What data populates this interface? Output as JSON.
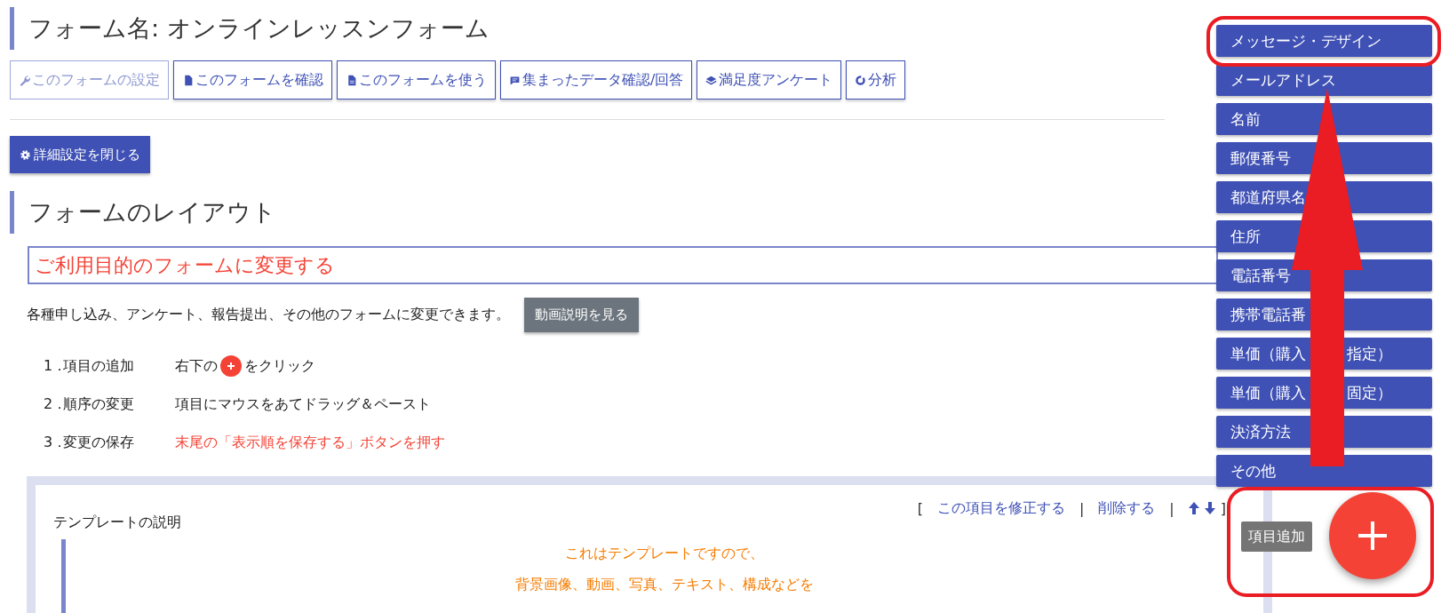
{
  "title": "フォーム名: オンラインレッスンフォーム",
  "toolbar": [
    {
      "label": "このフォームの設定",
      "disabled": true
    },
    {
      "label": "このフォームを確認",
      "disabled": false
    },
    {
      "label": "このフォームを使う",
      "disabled": false
    },
    {
      "label": "集まったデータ確認/回答",
      "disabled": false
    },
    {
      "label": "満足度アンケート",
      "disabled": false
    },
    {
      "label": "分析",
      "disabled": false
    }
  ],
  "detail_button": "詳細設定を閉じる",
  "layout_heading": "フォームのレイアウト",
  "purpose_banner": "ご利用目的のフォームに変更する",
  "description": "各種申し込み、アンケート、報告提出、その他のフォームに変更できます。",
  "video_button": "動画説明を見る",
  "steps": [
    {
      "kind": "plus_hint",
      "number": "1．",
      "title": "項目の追加",
      "text": "右下の",
      "text_after": "をクリック"
    },
    {
      "kind": "plain",
      "number": "2．",
      "title": "順序の変更",
      "text": "項目にマウスをあてドラッグ＆ペースト"
    },
    {
      "kind": "warning",
      "number": "3．",
      "title": "変更の保存",
      "text": "末尾の「表示順を保存する」ボタンを押す"
    }
  ],
  "template": {
    "actions": [
      {
        "kind": "mark",
        "text": "["
      },
      {
        "kind": "link",
        "text": "この項目を修正する"
      },
      {
        "kind": "mark",
        "text": "|"
      },
      {
        "kind": "link",
        "text": "削除する"
      },
      {
        "kind": "mark",
        "text": "|"
      },
      {
        "kind": "arrows"
      },
      {
        "kind": "mark",
        "text": "]"
      }
    ],
    "label": "テンプレートの説明",
    "body": [
      "これはテンプレートですので、",
      "背景画像、動画、写真、テキスト、構成などを"
    ]
  },
  "add_menu": [
    {
      "label": "メッセージ・デザイン"
    },
    {
      "label": "メールアドレス"
    },
    {
      "label": "名前"
    },
    {
      "label": "郵便番号"
    },
    {
      "label": "都道府県名"
    },
    {
      "label": "住所"
    },
    {
      "label": "電話番号"
    },
    {
      "label": "携帯電話番"
    },
    {
      "label": "単価（購入",
      "label_end": "指定）"
    },
    {
      "label": "単価（購入",
      "label_end": "固定）"
    },
    {
      "label": "決済方法"
    },
    {
      "label": "その他"
    }
  ],
  "fab_tooltip": "項目追加"
}
